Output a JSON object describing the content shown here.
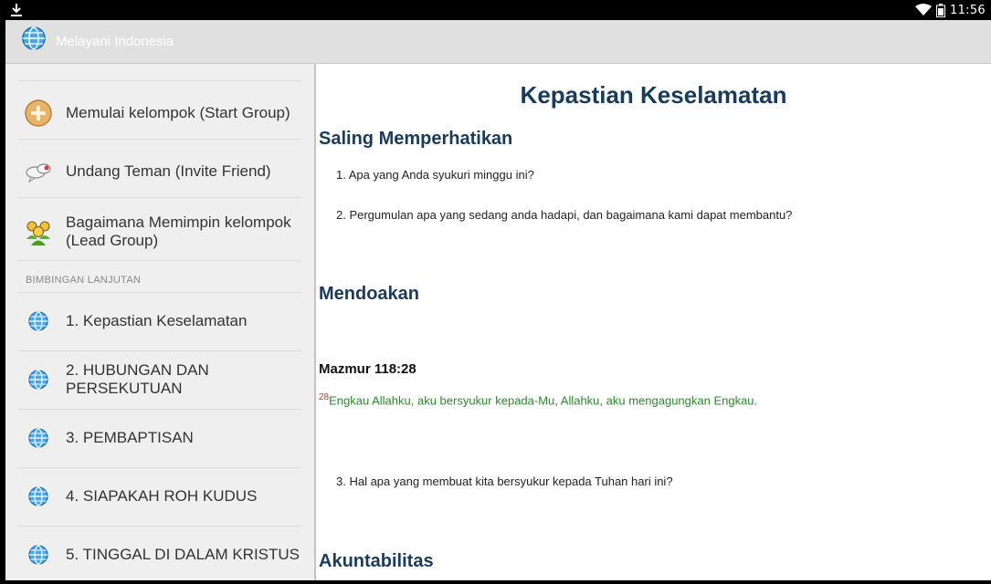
{
  "status_bar": {
    "time": "11:56",
    "icons": [
      "download-icon",
      "wifi-icon",
      "battery-icon"
    ]
  },
  "action_bar": {
    "title": "Melayani Indonesia",
    "logo_icon": "globe-icon"
  },
  "drawer": {
    "items": [
      {
        "label": "Memulai kelompok (Start Group)",
        "icon": "add-circle-icon"
      },
      {
        "label": "Undang Teman (Invite Friend)",
        "icon": "chat-bubbles-icon"
      },
      {
        "label": "Bagaimana Memimpin kelompok (Lead Group)",
        "icon": "group-people-icon"
      }
    ],
    "section_header": "BIMBINGAN LANJUTAN",
    "lessons": [
      {
        "label": "1. Kepastian Keselamatan",
        "icon": "globe-icon"
      },
      {
        "label": "2. HUBUNGAN DAN PERSEKUTUAN",
        "icon": "globe-icon"
      },
      {
        "label": "3. PEMBAPTISAN",
        "icon": "globe-icon"
      },
      {
        "label": "4. SIAPAKAH ROH KUDUS",
        "icon": "globe-icon"
      },
      {
        "label": "5. TINGGAL DI DALAM KRISTUS",
        "icon": "globe-icon"
      }
    ]
  },
  "content": {
    "title": "Kepastian Keselamatan",
    "section1": "Saling Memperhatikan",
    "q1": "1. Apa yang Anda syukuri minggu ini?",
    "q2": "2. Pergumulan apa yang sedang anda hadapi, dan bagaimana kami dapat membantu?",
    "section2": "Mendoakan",
    "scripture_ref": "Mazmur 118:28",
    "verse_number": "28",
    "verse_text": "Engkau Allahku, aku bersyukur kepada-Mu, Allahku, aku mengagungkan Engkau.",
    "q3": "3. Hal apa yang membuat kita bersyukur kepada Tuhan hari ini?",
    "section3": "Akuntabilitas"
  },
  "colors": {
    "heading": "#1a3b5c",
    "verse": "#2a8a2a",
    "verse_number": "#c0392b",
    "action_bar": "#e0e0e0",
    "drawer_bg": "#efefef"
  }
}
